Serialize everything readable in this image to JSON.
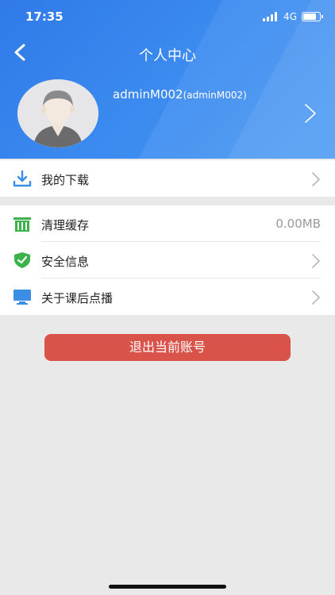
{
  "status_bar": {
    "time": "17:35",
    "network": "4G",
    "battery_level": 0.8
  },
  "header": {
    "title": "个人中心",
    "back_icon": "chevron-left-icon"
  },
  "profile": {
    "username": "adminM002",
    "account_id": "(adminM002)",
    "avatar_icon": "default-avatar-icon"
  },
  "menu_primary": [
    {
      "label": "我的下载",
      "icon": "download-icon",
      "color": "#3a8ee6"
    }
  ],
  "menu_secondary": [
    {
      "label": "清理缓存",
      "icon": "trash-icon",
      "value": "0.00MB",
      "color": "#3bb34a"
    },
    {
      "label": "安全信息",
      "icon": "shield-check-icon",
      "color": "#3bb34a"
    },
    {
      "label": "关于课后点播",
      "icon": "monitor-icon",
      "color": "#3a8ee6"
    }
  ],
  "logout": {
    "label": "退出当前账号",
    "color": "#d9534a"
  },
  "colors": {
    "header": "#3583ec",
    "background": "#e9e9ea"
  }
}
